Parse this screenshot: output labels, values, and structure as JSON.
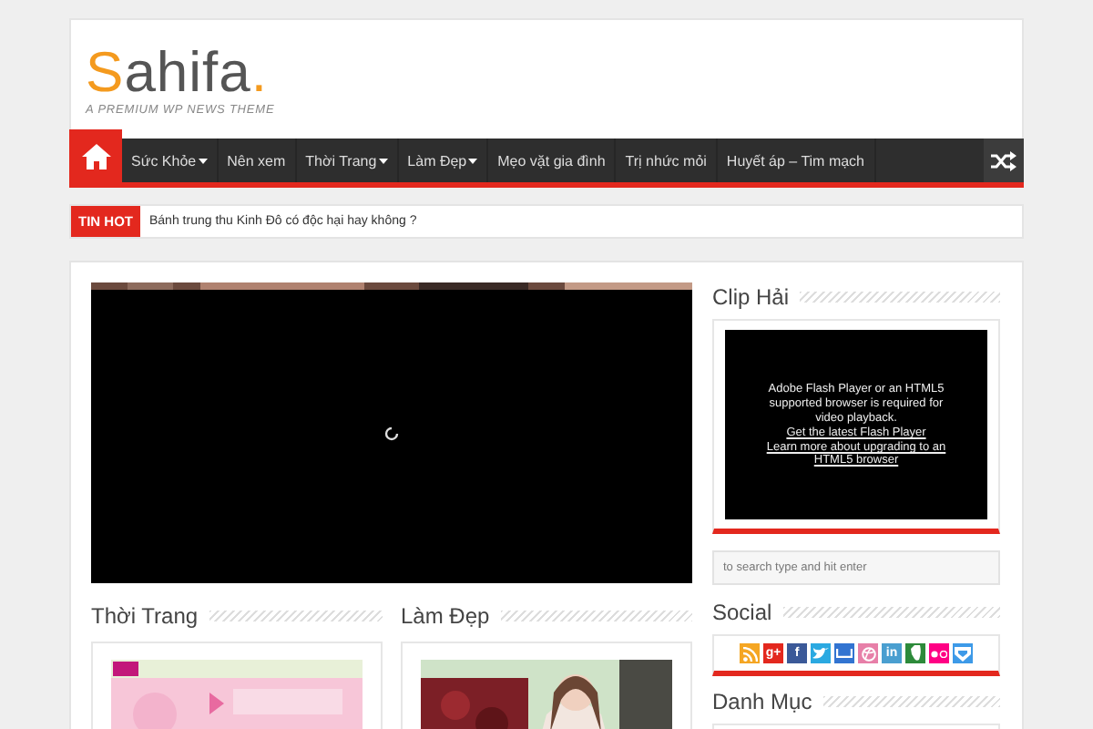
{
  "logo": {
    "first": "S",
    "rest": "ahifa",
    "dot": ".",
    "tagline": "A PREMIUM WP NEWS THEME"
  },
  "nav": {
    "items": [
      {
        "kind": "home",
        "selected": true
      },
      {
        "label": "Sức Khỏe",
        "dropdown": true,
        "selected": false
      },
      {
        "label": "Nên xem",
        "dropdown": false,
        "selected": false
      },
      {
        "label": "Thời Trang",
        "dropdown": true,
        "selected": false
      },
      {
        "label": "Làm Đẹp",
        "dropdown": true,
        "selected": false
      },
      {
        "label": "Mẹo vặt gia đình",
        "dropdown": false,
        "selected": false
      },
      {
        "label": "Trị nhức mỏi",
        "dropdown": false,
        "selected": false
      },
      {
        "label": "Huyết áp – Tim mạch",
        "dropdown": false,
        "selected": false
      }
    ]
  },
  "breaking": {
    "label": "TIN HOT",
    "headline": "Bánh trung thu Kinh Đô có độc hại hay không ?"
  },
  "sections": [
    {
      "title": "Thời Trang"
    },
    {
      "title": "Làm Đẹp"
    }
  ],
  "sidebar": {
    "clip": {
      "title": "Clip Hải",
      "message": [
        "Adobe Flash Player or an HTML5",
        "supported browser is required for",
        "video playback."
      ],
      "links": [
        "Get the latest Flash Player",
        "Learn more about upgrading to an HTML5 browser"
      ]
    },
    "search": {
      "placeholder": "to search type and hit enter"
    },
    "social": {
      "title": "Social",
      "icons": [
        {
          "kind": "rss",
          "color": "#f5a623"
        },
        {
          "kind": "letter",
          "label": "g+",
          "color": "#e3281e"
        },
        {
          "kind": "letter",
          "label": "f",
          "color": "#3b5998"
        },
        {
          "kind": "twitter",
          "color": "#2ba9e1"
        },
        {
          "kind": "bar",
          "color": "#3274d1"
        },
        {
          "kind": "ball",
          "color": "#e77fa8"
        },
        {
          "kind": "letter",
          "label": "in",
          "color": "#4a9fd0"
        },
        {
          "kind": "leaf",
          "color": "#2d8a3a"
        },
        {
          "kind": "dots",
          "color": "#ff0084"
        },
        {
          "kind": "box",
          "color": "#3d9ae8"
        }
      ]
    },
    "categories": {
      "title": "Danh Mục"
    }
  }
}
